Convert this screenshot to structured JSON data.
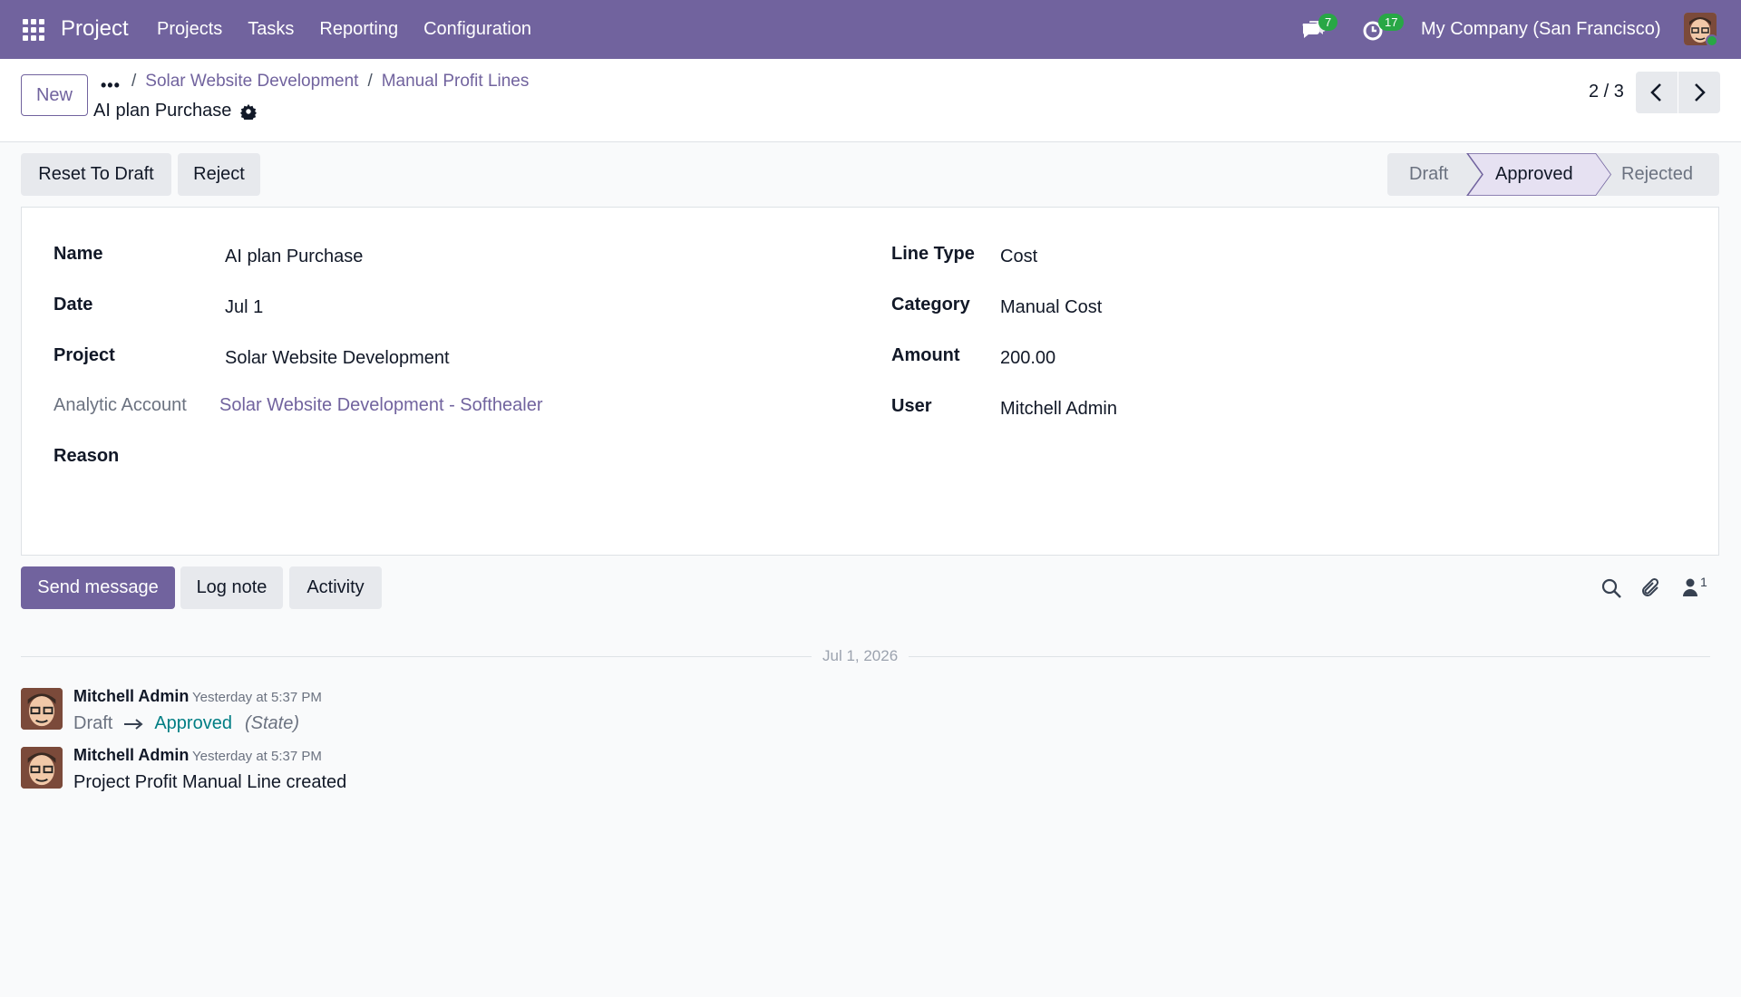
{
  "navbar": {
    "brand": "Project",
    "menu": [
      "Projects",
      "Tasks",
      "Reporting",
      "Configuration"
    ],
    "messages_count": "7",
    "activities_count": "17",
    "company": "My Company (San Francisco)"
  },
  "control": {
    "new_label": "New",
    "more_label": "•••",
    "breadcrumb": [
      "Solar Website Development",
      "Manual Profit Lines"
    ],
    "breadcrumb_sep": "/",
    "record_title": "AI plan Purchase",
    "pager": "2 / 3"
  },
  "actions": {
    "reset_label": "Reset To Draft",
    "reject_label": "Reject"
  },
  "status": {
    "stages": [
      "Draft",
      "Approved",
      "Rejected"
    ],
    "current": "Approved"
  },
  "form": {
    "left": [
      {
        "label": "Name",
        "value": "AI plan Purchase"
      },
      {
        "label": "Date",
        "value": "Jul 1"
      },
      {
        "label": "Project",
        "value": "Solar Website Development"
      },
      {
        "label": "Analytic Account",
        "value": "Solar Website Development - Softhealer"
      },
      {
        "label": "Reason",
        "value": ""
      }
    ],
    "right": [
      {
        "label": "Line Type",
        "value": "Cost"
      },
      {
        "label": "Category",
        "value": "Manual Cost"
      },
      {
        "label": "Amount",
        "value": "200.00"
      },
      {
        "label": "User",
        "value": "Mitchell Admin"
      }
    ]
  },
  "chatter": {
    "send_message": "Send message",
    "log_note": "Log note",
    "activity": "Activity",
    "followers_count": "1",
    "date_separator": "Jul 1, 2026",
    "messages": [
      {
        "author": "Mitchell Admin",
        "time": "Yesterday at 5:37 PM",
        "from": "Draft",
        "to": "Approved",
        "field": "(State)"
      },
      {
        "author": "Mitchell Admin",
        "time": "Yesterday at 5:37 PM",
        "body": "Project Profit Manual Line created"
      }
    ]
  },
  "colors": {
    "brand": "#71639e",
    "badge": "#28a745",
    "tracking_value": "#017e84"
  }
}
